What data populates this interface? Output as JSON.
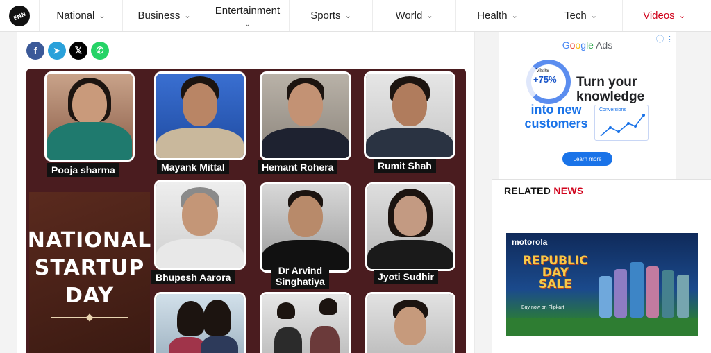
{
  "nav": {
    "logo_text": "ENN",
    "items": [
      {
        "label": "National"
      },
      {
        "label": "Business"
      },
      {
        "label": "Entertainment"
      },
      {
        "label": "Sports"
      },
      {
        "label": "World"
      },
      {
        "label": "Health"
      },
      {
        "label": "Tech"
      },
      {
        "label": "Videos"
      }
    ],
    "chevron": "⌄"
  },
  "share": {
    "facebook": "f",
    "telegram": "➤",
    "x": "𝕏",
    "whatsapp": "✆"
  },
  "banner": {
    "people": [
      {
        "name": "Pooja sharma"
      },
      {
        "name": "Mayank Mittal"
      },
      {
        "name": "Hemant Rohera"
      },
      {
        "name": "Rumit Shah"
      },
      {
        "name": "Bhupesh Aarora"
      },
      {
        "name_line1": "Dr Arvind",
        "name_line2": "Singhatiya"
      },
      {
        "name": "Jyoti Sudhir"
      }
    ],
    "title_lines": [
      "NATIONAL",
      "STARTUP",
      "DAY"
    ]
  },
  "ad": {
    "brand": [
      "G",
      "o",
      "o",
      "g",
      "le",
      " Ads"
    ],
    "visits_label": "Visits",
    "visits_value": "+75%",
    "headline": "Turn your knowledge",
    "sub": "into new customers",
    "chart_title": "Conversions",
    "cta": "Learn more",
    "controls": "ⓘ ⋮"
  },
  "related": {
    "title_a": "RELATED ",
    "title_b": "NEWS"
  },
  "promo": {
    "brand": "motorola",
    "line1": "REPUBLIC",
    "line2": "DAY",
    "line3": "SALE",
    "buy": "Buy now on Flipkart"
  },
  "colors": {
    "accent_red": "#d0021b",
    "banner_bg": "#4a1c1f",
    "facebook": "#3b5998",
    "telegram": "#2aa1da",
    "whatsapp": "#25d366"
  }
}
